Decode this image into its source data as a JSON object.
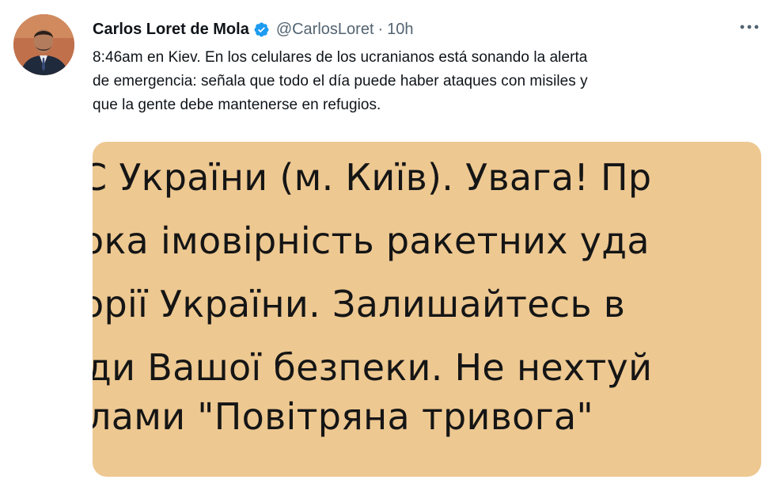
{
  "author": {
    "display_name": "Carlos Loret de Mola",
    "handle": "@CarlosLoret",
    "separator": "·",
    "time": "10h",
    "verified": true
  },
  "tweet": {
    "text_lines": [
      "8:46am en Kiev. En los celulares de los ucranianos está sonando la alerta",
      "de emergencia: señala que todo el día puede haber ataques con misiles y",
      "que la gente debe mantenerse en refugios."
    ]
  },
  "media": {
    "background_color": "#edc891",
    "lines": [
      "С України (м. Київ). Увага! Пр",
      "ока імовірність ракетних уда",
      "орії України. Залишайтесь в",
      "ди Вашої безпеки. Не нехтуй",
      "лами \"Повітряна тривога\""
    ]
  },
  "icons": {
    "verified": "verified-badge-icon",
    "more": "more-options-icon"
  },
  "colors": {
    "accent": "#1d9bf0",
    "secondary_text": "#536471"
  }
}
